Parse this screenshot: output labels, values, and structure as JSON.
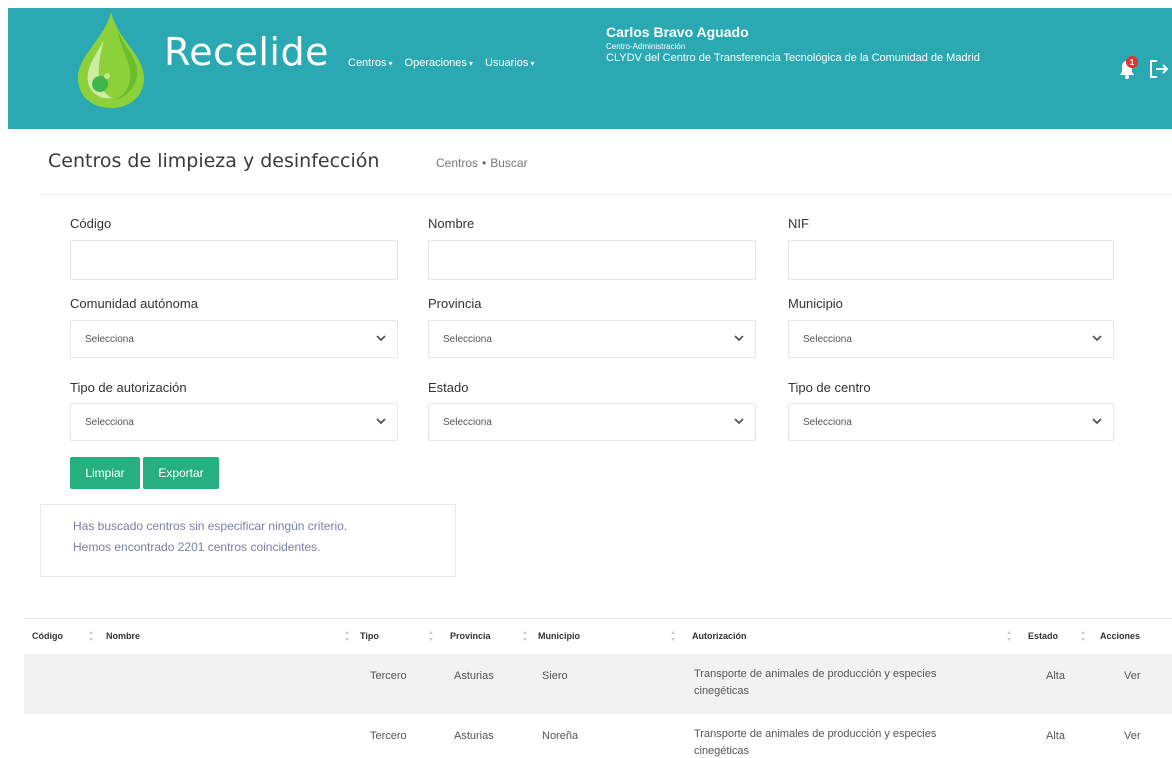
{
  "app": {
    "name": "Recelide",
    "nav": [
      {
        "label": "Centros"
      },
      {
        "label": "Operaciones"
      },
      {
        "label": "Usuarios"
      }
    ],
    "user": {
      "name": "Carlos Bravo Aguado",
      "role": "Centro-Administración",
      "organization": "CLYDV del Centro de Transferencia Tecnológica de la Comunidad de Madrid"
    },
    "notifications": {
      "count": "1"
    }
  },
  "page": {
    "title": "Centros de limpieza y desinfección",
    "breadcrumb": [
      "Centros",
      "Buscar"
    ],
    "breadcrumb_separator": "•"
  },
  "form": {
    "codigo_label": "Código",
    "nombre_label": "Nombre",
    "nif_label": "NIF",
    "codigo_value": "",
    "nombre_value": "",
    "nif_value": "",
    "comunidad_label": "Comunidad autónoma",
    "provincia_label": "Provincia",
    "municipio_label": "Municipio",
    "tipo_autorizacion_label": "Tipo de autorización",
    "estado_label": "Estado",
    "tipo_centro_label": "Tipo de centro",
    "select_value": "Selecciona",
    "clear_button": "Limpiar",
    "export_button": "Exportar"
  },
  "info": {
    "line1": "Has buscado centros sin especificar ningún criterio.",
    "line2": "Hemos encontrado 2201 centros coincidentes."
  },
  "table": {
    "headers": {
      "codigo": "Código",
      "nombre": "Nombre",
      "tipo": "Tipo",
      "provincia": "Provincia",
      "municipio": "Municipio",
      "autorizacion": "Autorización",
      "estado": "Estado",
      "acciones": "Acciones"
    },
    "rows": [
      {
        "codigo": "",
        "nombre": "",
        "tipo": "Tercero",
        "provincia": "Asturias",
        "municipio": "Siero",
        "autorizacion_l1": "Transporte de animales de producción y especies",
        "autorizacion_l2": "cinegéticas",
        "estado": "Alta",
        "accion": "Ver"
      },
      {
        "codigo": "",
        "nombre": "",
        "tipo": "Tercero",
        "provincia": "Asturias",
        "municipio": "Noreña",
        "autorizacion_l1": "Transporte de animales de producción y especies",
        "autorizacion_l2": "cinegéticas",
        "estado": "Alta",
        "accion": "Ver"
      }
    ]
  },
  "colors": {
    "header_bg": "#2aa9b3",
    "button_green": "#26b07d",
    "logo_green": "#8cd13a",
    "badge_red": "#e3342f"
  },
  "icons": [
    "logo-droplet",
    "bell-icon",
    "logout-icon",
    "chevron-down-icon",
    "sort-icon"
  ]
}
